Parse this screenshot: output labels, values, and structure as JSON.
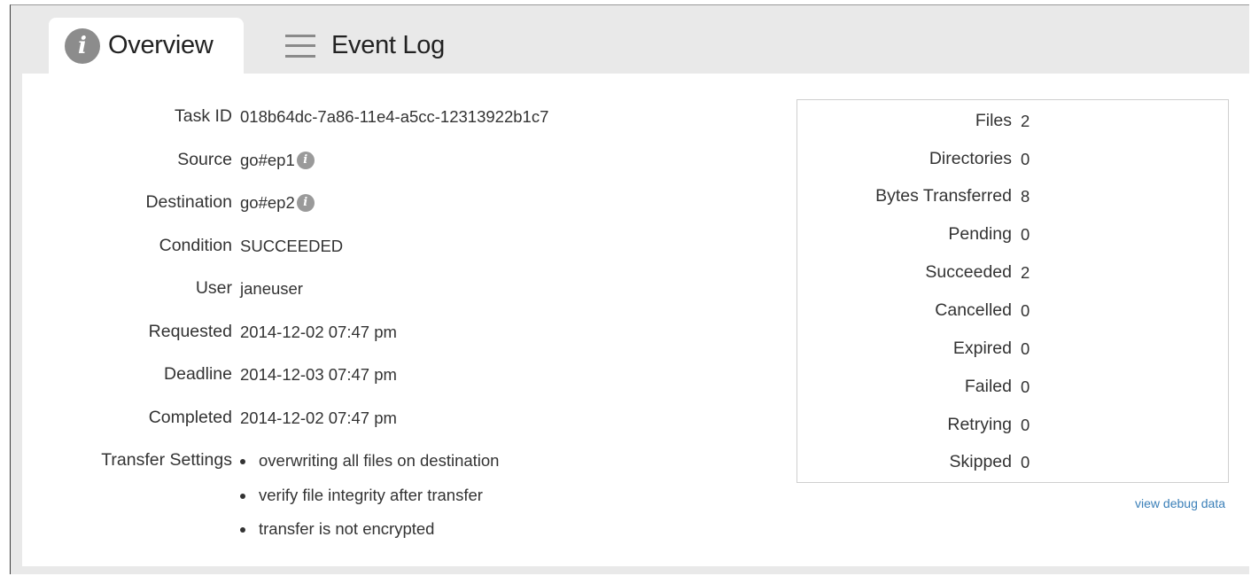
{
  "tabs": {
    "overview_label": "Overview",
    "overview_icon": "info-icon",
    "eventlog_label": "Event Log",
    "eventlog_icon": "menu-icon"
  },
  "details": [
    {
      "label": "Task ID",
      "value": "018b64dc-7a86-11e4-a5cc-12313922b1c7"
    },
    {
      "label": "Source",
      "value": "go#ep1",
      "info": true
    },
    {
      "label": "Destination",
      "value": "go#ep2",
      "info": true
    },
    {
      "label": "Condition",
      "value": "SUCCEEDED"
    },
    {
      "label": "User",
      "value": "janeuser"
    },
    {
      "label": "Requested",
      "value": "2014-12-02 07:47 pm"
    },
    {
      "label": "Deadline",
      "value": "2014-12-03 07:47 pm"
    },
    {
      "label": "Completed",
      "value": "2014-12-02 07:47 pm"
    }
  ],
  "transfer_settings": {
    "label": "Transfer Settings",
    "items": [
      "overwriting all files on destination",
      "verify file integrity after transfer",
      "transfer is not encrypted"
    ]
  },
  "stats": [
    {
      "label": "Files",
      "value": "2"
    },
    {
      "label": "Directories",
      "value": "0"
    },
    {
      "label": "Bytes Transferred",
      "value": "8"
    },
    {
      "label": "Pending",
      "value": "0"
    },
    {
      "label": "Succeeded",
      "value": "2"
    },
    {
      "label": "Cancelled",
      "value": "0"
    },
    {
      "label": "Expired",
      "value": "0"
    },
    {
      "label": "Failed",
      "value": "0"
    },
    {
      "label": "Retrying",
      "value": "0"
    },
    {
      "label": "Skipped",
      "value": "0"
    }
  ],
  "debug_link": "view debug data",
  "info_glyph": "i",
  "colors": {
    "link": "#3a7fb8",
    "icon_gray": "#8c8c8c",
    "frame_bg": "#e9e9e9"
  }
}
